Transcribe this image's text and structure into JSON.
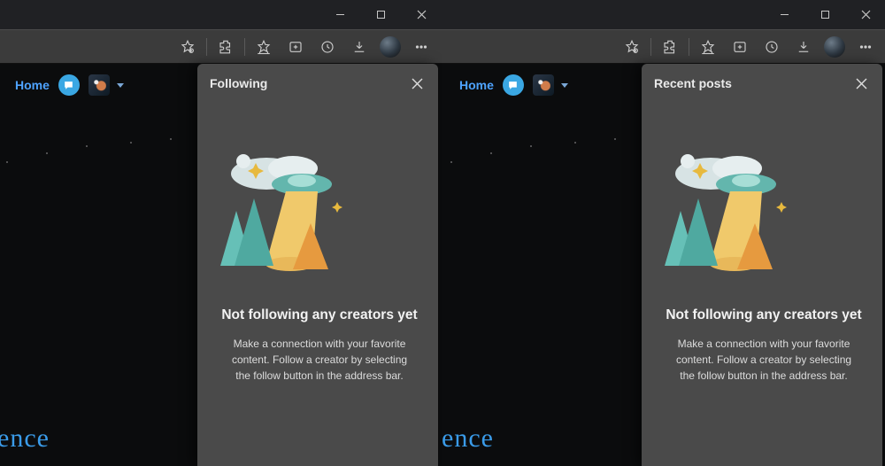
{
  "windows": [
    {
      "home_label": "Home",
      "panel_title": "Following",
      "empty_title": "Not following any creators yet",
      "empty_body": "Make a connection with your favorite content. Follow a creator by selecting the follow button in the address bar.",
      "page_fragment": "ence"
    },
    {
      "home_label": "Home",
      "panel_title": "Recent posts",
      "empty_title": "Not following any creators yet",
      "empty_body": "Make a connection with your favorite content. Follow a creator by selecting the follow button in the address bar.",
      "page_fragment": "ence"
    }
  ],
  "icons": {
    "minimize": "minimize-icon",
    "maximize": "maximize-icon",
    "close": "close-icon",
    "star": "favorite-star-icon",
    "extensions": "extensions-icon",
    "favorites": "favorites-icon",
    "collections": "collections-icon",
    "history": "history-icon",
    "downloads": "downloads-icon",
    "more": "more-icon"
  }
}
